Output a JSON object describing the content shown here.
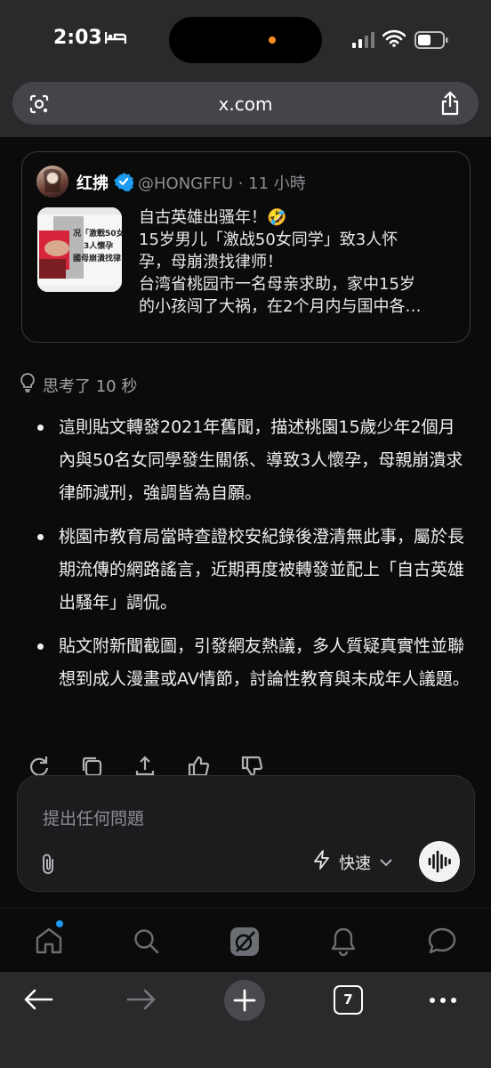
{
  "status": {
    "time": "2:03"
  },
  "browser": {
    "url": "x.com",
    "tab_count": "7"
  },
  "quoted_post": {
    "name": "红拂",
    "handle_time": "@HONGFFU · 11 小時",
    "lines": [
      "自古英雄出骚年！🤣",
      "15岁男儿「激战50女同学」致3人怀",
      "孕，母崩溃找律师！",
      "台湾省桃园市一名母亲求助，家中15岁",
      "的小孩闯了大祸，在2个月内与国中各…"
    ],
    "thumb_text": [
      "况「激戰50女",
      "3人懷孕",
      "國母崩潰找律"
    ]
  },
  "answer": {
    "thinking_label": "思考了 10 秒",
    "bullets": [
      "這則貼文轉發2021年舊聞，描述桃園15歲少年2個月內與50名女同學發生關係、導致3人懷孕，母親崩潰求律師減刑，強調皆為自願。",
      "桃園市教育局當時查證校安紀錄後澄清無此事，屬於長期流傳的網路謠言，近期再度被轉發並配上「自古英雄出騷年」調侃。",
      "貼文附新聞截圖，引發網友熱議，多人質疑真實性並聯想到成人漫畫或AV情節，討論性教育與未成年人議題。"
    ]
  },
  "composer": {
    "placeholder": "提出任何問題",
    "mode_label": "快速"
  },
  "colors": {
    "accent": "#1d9bf0",
    "verified": "#1d9bf0",
    "status_dot": "#ff8a1f"
  }
}
